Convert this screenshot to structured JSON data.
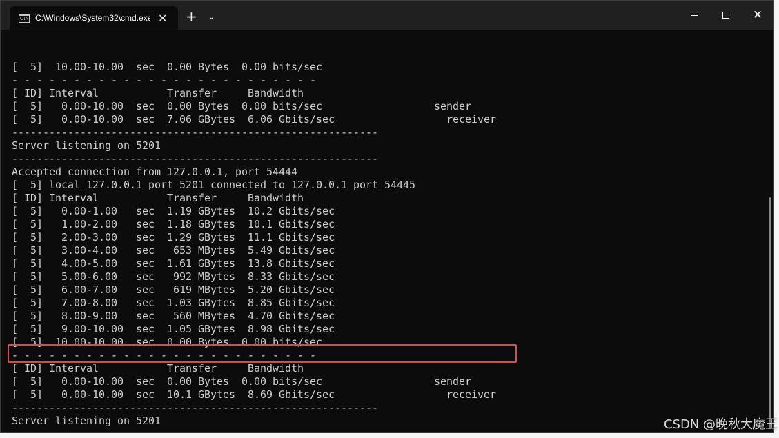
{
  "window": {
    "tab_title": "C:\\Windows\\System32\\cmd.exe",
    "tab_close": "✕",
    "new_tab": "+",
    "dropdown": "⌄",
    "close_glyph": "✕"
  },
  "console": {
    "lines": [
      "[  5]  10.00-10.00  sec  0.00 Bytes  0.00 bits/sec",
      "- - - - - - - - - - - - - - - - - - - - - - - - -",
      "[ ID] Interval           Transfer     Bandwidth",
      "[  5]   0.00-10.00  sec  0.00 Bytes  0.00 bits/sec                  sender",
      "[  5]   0.00-10.00  sec  7.06 GBytes  6.06 Gbits/sec                  receiver",
      "-----------------------------------------------------------",
      "Server listening on 5201",
      "-----------------------------------------------------------",
      "Accepted connection from 127.0.0.1, port 54444",
      "[  5] local 127.0.0.1 port 5201 connected to 127.0.0.1 port 54445",
      "[ ID] Interval           Transfer     Bandwidth",
      "[  5]   0.00-1.00   sec  1.19 GBytes  10.2 Gbits/sec",
      "[  5]   1.00-2.00   sec  1.18 GBytes  10.1 Gbits/sec",
      "[  5]   2.00-3.00   sec  1.29 GBytes  11.1 Gbits/sec",
      "[  5]   3.00-4.00   sec   653 MBytes  5.49 Gbits/sec",
      "[  5]   4.00-5.00   sec  1.61 GBytes  13.8 Gbits/sec",
      "[  5]   5.00-6.00   sec   992 MBytes  8.33 Gbits/sec",
      "[  5]   6.00-7.00   sec   619 MBytes  5.20 Gbits/sec",
      "[  5]   7.00-8.00   sec  1.03 GBytes  8.85 Gbits/sec",
      "[  5]   8.00-9.00   sec   560 MBytes  4.70 Gbits/sec",
      "[  5]   9.00-10.00  sec  1.05 GBytes  8.98 Gbits/sec",
      "[  5]  10.00-10.00  sec  0.00 Bytes  0.00 bits/sec",
      "- - - - - - - - - - - - - - - - - - - - - - - - -",
      "[ ID] Interval           Transfer     Bandwidth",
      "[  5]   0.00-10.00  sec  0.00 Bytes  0.00 bits/sec                  sender",
      "[  5]   0.00-10.00  sec  10.1 GBytes  8.69 Gbits/sec                  receiver",
      "-----------------------------------------------------------",
      "Server listening on 5201",
      "-----------------------------------------------------------"
    ]
  },
  "watermark": "CSDN @晚秋大魔王"
}
